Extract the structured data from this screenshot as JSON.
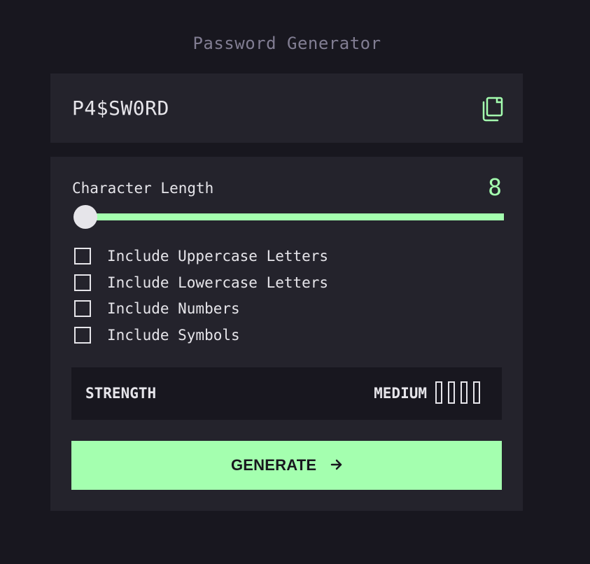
{
  "header": {
    "title": "Password Generator"
  },
  "output": {
    "password": "P4$SW0RD",
    "copy_icon": "copy-icon"
  },
  "length": {
    "label": "Character Length",
    "value": "8"
  },
  "options": [
    {
      "label": "Include Uppercase Letters",
      "checked": false
    },
    {
      "label": "Include Lowercase Letters",
      "checked": false
    },
    {
      "label": "Include Numbers",
      "checked": false
    },
    {
      "label": "Include Symbols",
      "checked": false
    }
  ],
  "strength": {
    "label": "STRENGTH",
    "value": "MEDIUM",
    "bars_filled": 0,
    "bars_total": 4
  },
  "generate": {
    "label": "GENERATE",
    "icon": "arrow-right-icon"
  },
  "colors": {
    "background": "#18171f",
    "panel": "#24232c",
    "accent": "#a4ffaf",
    "text": "#e6e5ea",
    "muted": "#817d92"
  }
}
